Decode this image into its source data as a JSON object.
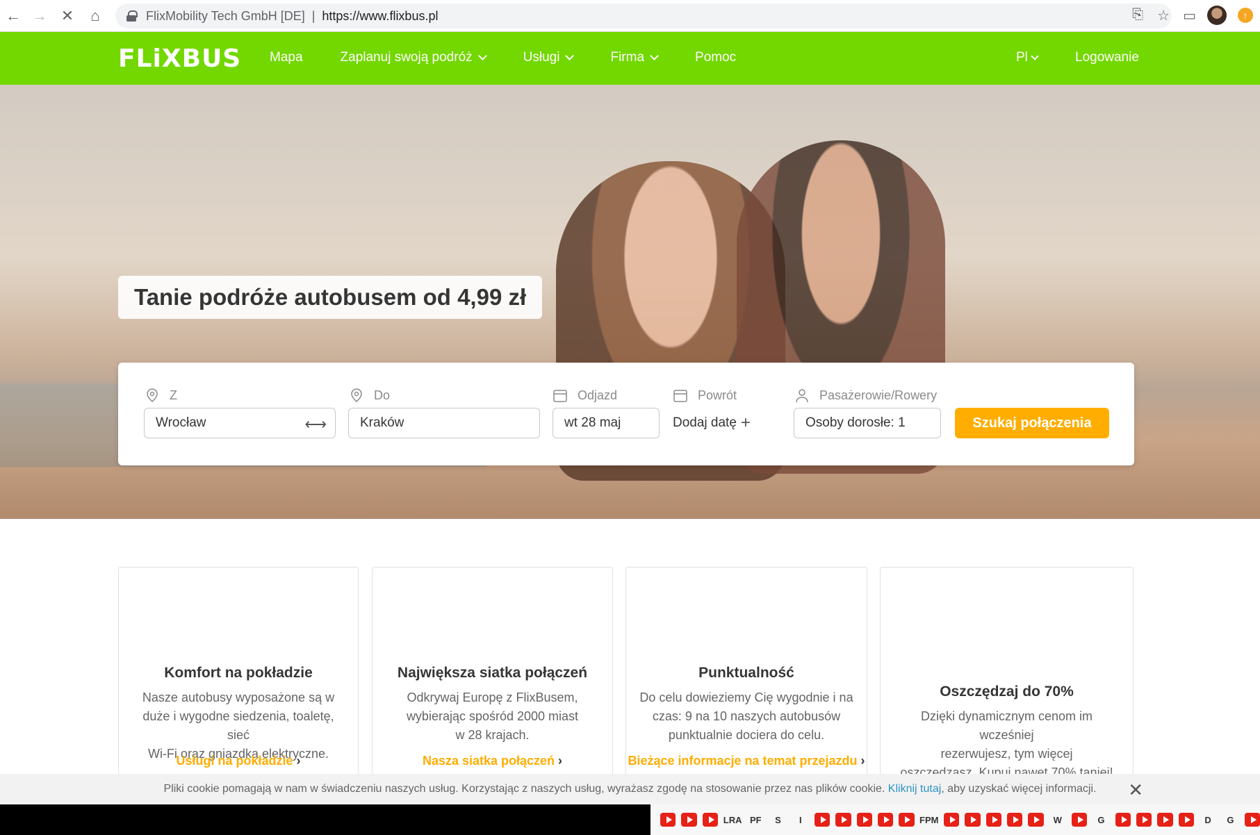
{
  "browser": {
    "site_identity": "FlixMobility Tech GmbH [DE]",
    "separator": "|",
    "url": "https://www.flixbus.pl"
  },
  "header": {
    "logo": "FLiXBUS",
    "menu": [
      {
        "label": "Mapa",
        "dropdown": false
      },
      {
        "label": "Zaplanuj swoją podróż",
        "dropdown": true
      },
      {
        "label": "Usługi",
        "dropdown": true
      },
      {
        "label": "Firma",
        "dropdown": true
      },
      {
        "label": "Pomoc",
        "dropdown": false
      }
    ],
    "language": "Pl",
    "login": "Logowanie",
    "brand_color": "#73d700"
  },
  "hero": {
    "tagline": "Tanie podróże autobusem od 4,99 zł"
  },
  "search": {
    "from_label": "Z",
    "from_value": "Wrocław",
    "to_label": "Do",
    "to_value": "Kraków",
    "departure_label": "Odjazd",
    "departure_value": "wt 28 maj",
    "return_label": "Powrót",
    "return_add": "Dodaj datę",
    "passengers_label": "Pasażerowie/Rowery",
    "passengers_value": "Osoby dorosłe: 1",
    "submit": "Szukaj połączenia",
    "accent_color": "#ffad00"
  },
  "features": [
    {
      "title": "Komfort na pokładzie",
      "lines": [
        "Nasze autobusy wyposażone są w",
        "duże i wygodne siedzenia, toaletę, sieć",
        "Wi-Fi oraz gniazdka elektryczne."
      ],
      "link": "Usługi na pokładzie"
    },
    {
      "title": "Największa siatka połączeń",
      "lines": [
        "Odkrywaj Europę z FlixBusem,",
        "wybierając spośród 2000 miast",
        "w 28 krajach."
      ],
      "link": "Nasza siatka połączeń"
    },
    {
      "title": "Punktualność",
      "lines": [
        "Do celu dowieziemy Cię wygodnie i na",
        "czas: 9 na 10 naszych autobusów",
        "punktualnie dociera do celu."
      ],
      "link": "Bieżące informacje na temat przejazdu"
    },
    {
      "title": "Oszczędzaj do 70%",
      "lines": [
        "Dzięki dynamicznym cenom im wcześniej",
        "rezerwujesz, tym więcej",
        "oszczędzasz. Kupuj nawet 70% taniej!"
      ],
      "link": ""
    }
  ],
  "cookie": {
    "text": "Pliki cookie pomagają w nam w świadczeniu naszych usług. Korzystając z naszych usług, wyrażasz zgodę na stosowanie przez nas plików cookie.",
    "link": "Kliknij tutaj",
    "suffix": ", aby uzyskać więcej informacji.",
    "close": "✕"
  },
  "bookmarks": [
    "yt",
    "yt",
    "yt",
    "LRA",
    "PF",
    "S",
    "I",
    "yt",
    "yt",
    "yt",
    "yt",
    "yt",
    "FPM",
    "yt",
    "yt",
    "yt",
    "yt",
    "yt",
    "W",
    "yt",
    "G",
    "yt",
    "yt",
    "yt",
    "yt",
    "D",
    "G",
    "yt"
  ]
}
